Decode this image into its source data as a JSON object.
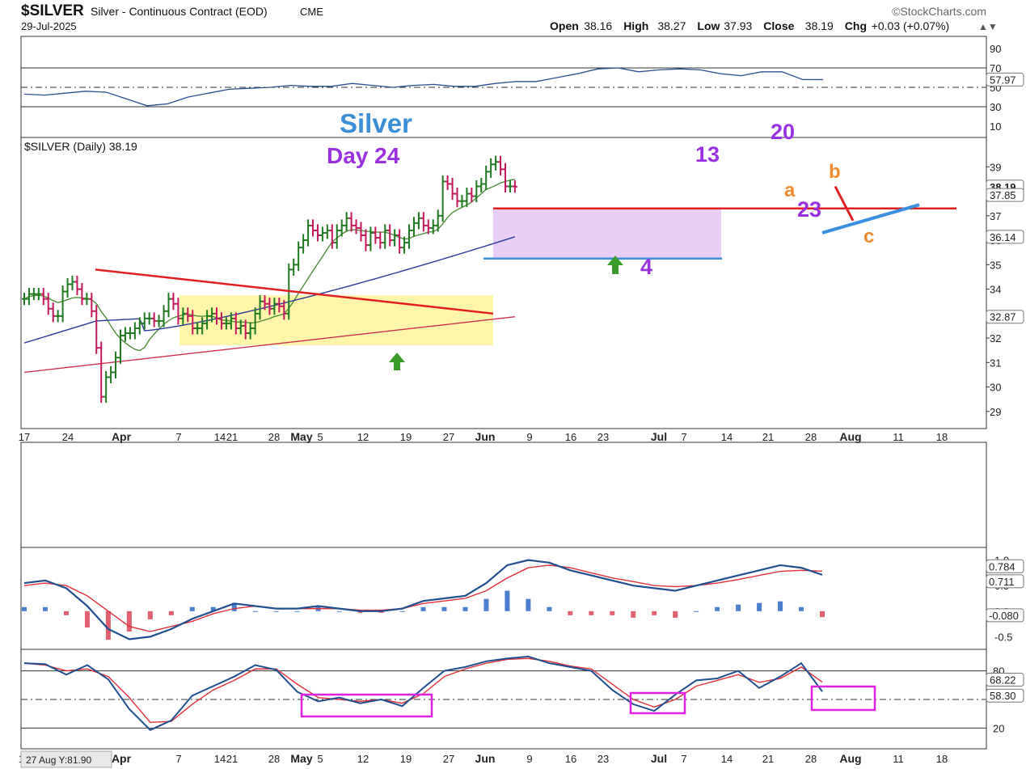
{
  "header": {
    "symbol": "$SILVER",
    "name": "Silver - Continuous Contract (EOD)",
    "exchange": "CME",
    "date": "29-Jul-2025",
    "brand": "©StockCharts.com",
    "ohlc": [
      {
        "label": "Open",
        "value": "38.16"
      },
      {
        "label": "High",
        "value": "38.27"
      },
      {
        "label": "Low",
        "value": "37.93"
      },
      {
        "label": "Close",
        "value": "38.19"
      },
      {
        "label": "Chg",
        "value": "+0.03 (+0.07%)"
      }
    ]
  },
  "colors": {
    "up": "#1f7a1f",
    "down": "#c2185b",
    "ma_short": "#4f8f3a",
    "ma_mid": "#2a3a9a",
    "ma_long": "#d03050",
    "macd": "#1f4f8f",
    "signal": "#e0303a",
    "hist_pos": "#4a7fd0",
    "hist_neg": "#e06070",
    "resistance": "#e02020",
    "support": "#3b8fe0",
    "highlight_yellow": "#fff59a",
    "highlight_purple": "#e6c8f5",
    "annotation_purple": "#9b30e0",
    "annotation_orange": "#f08a30",
    "annotation_blue": "#3a8fd8",
    "box_magenta": "#e020e0"
  },
  "annotations": {
    "title": "Silver",
    "day": "Day 24",
    "cycle_labels": [
      "13",
      "20",
      "23",
      "4"
    ],
    "wave_labels": [
      "a",
      "b",
      "c"
    ]
  },
  "price_panel": {
    "legend": "$SILVER (Daily) 38.19",
    "last_label": "38.19",
    "ma_labels": [
      "37.85",
      "36.14",
      "32.87"
    ],
    "y_ticks": [
      "39",
      "38",
      "37",
      "36",
      "35",
      "34",
      "33",
      "32",
      "31",
      "30",
      "29"
    ]
  },
  "rsi_panel": {
    "value_label": "57.97",
    "y_ticks": [
      "90",
      "70",
      "50",
      "30",
      "10"
    ]
  },
  "macd_panel": {
    "value_labels": [
      "0.784",
      "0.711",
      "-0.080"
    ],
    "y_ticks": [
      "1.0",
      "0.5",
      "0.0",
      "-0.5"
    ]
  },
  "stoch_panel": {
    "value_labels": [
      "68.22",
      "58.30"
    ],
    "y_ticks": [
      "80",
      "20"
    ]
  },
  "x_axis": {
    "labels": [
      "17",
      "24",
      "Apr",
      "7",
      "14",
      "21",
      "28",
      "May",
      "5",
      "12",
      "19",
      "27",
      "Jun",
      "9",
      "16",
      "23",
      "Jul",
      "7",
      "14",
      "21",
      "28",
      "Aug",
      "11",
      "18"
    ],
    "bold": [
      "Apr",
      "May",
      "Jun",
      "Jul",
      "Aug"
    ]
  },
  "cursor_readout": "27 Aug Y:81.90",
  "chart_data": [
    {
      "type": "ohlc",
      "title": "$SILVER (Daily) 38.19",
      "ylim": [
        28.3,
        40.2
      ],
      "closes": [
        33.6,
        33.8,
        33.8,
        33.8,
        33.6,
        33.2,
        32.9,
        32.9,
        33.9,
        34.2,
        34.3,
        34.0,
        33.6,
        33.6,
        33.1,
        31.6,
        29.6,
        30.4,
        30.6,
        31.2,
        32.1,
        32.2,
        32.2,
        32.4,
        32.6,
        32.8,
        32.8,
        32.7,
        32.7,
        33.1,
        33.6,
        33.4,
        32.8,
        33.0,
        32.9,
        32.4,
        32.4,
        32.6,
        32.9,
        33.0,
        32.8,
        32.6,
        32.6,
        32.8,
        32.4,
        32.5,
        32.2,
        32.4,
        33.0,
        33.5,
        33.4,
        33.2,
        33.4,
        33.3,
        33.0,
        34.8,
        35.0,
        35.7,
        36.0,
        36.6,
        36.4,
        36.2,
        36.3,
        36.4,
        35.9,
        36.4,
        36.6,
        36.9,
        36.6,
        36.5,
        36.2,
        35.8,
        36.3,
        36.1,
        35.9,
        36.4,
        36.0,
        36.2,
        35.7,
        35.9,
        36.4,
        36.7,
        36.9,
        36.6,
        36.5,
        36.6,
        37.0,
        38.4,
        38.3,
        37.9,
        37.6,
        37.6,
        37.9,
        37.8,
        38.2,
        38.3,
        38.8,
        39.1,
        39.2,
        38.9,
        38.2,
        38.2,
        38.19
      ],
      "ma_short": {
        "start": 33.3,
        "end": 37.85
      },
      "ma_mid_last": 36.14,
      "ma_long_last": 32.87
    },
    {
      "type": "line",
      "title": "RSI",
      "ylim": [
        0,
        100
      ],
      "values": [
        43,
        42,
        44,
        46,
        45,
        38,
        31,
        33,
        40,
        44,
        48,
        49,
        50,
        52,
        51,
        51,
        54,
        52,
        50,
        52,
        53,
        51,
        51,
        54,
        56,
        56,
        60,
        64,
        69,
        70,
        66,
        68,
        69,
        68,
        64,
        62,
        66,
        66,
        58,
        57.97
      ],
      "levels": [
        70,
        50,
        30
      ]
    },
    {
      "type": "line",
      "title": "MACD",
      "ylim": [
        -0.7,
        1.2
      ],
      "macd": [
        0.55,
        0.6,
        0.45,
        0.1,
        -0.35,
        -0.55,
        -0.5,
        -0.35,
        -0.15,
        0.0,
        0.15,
        0.1,
        0.05,
        0.05,
        0.1,
        0.05,
        0.0,
        0.0,
        0.05,
        0.2,
        0.25,
        0.3,
        0.55,
        0.9,
        1.0,
        0.95,
        0.8,
        0.7,
        0.6,
        0.5,
        0.45,
        0.4,
        0.5,
        0.6,
        0.7,
        0.8,
        0.9,
        0.85,
        0.711
      ],
      "signal": [
        0.5,
        0.55,
        0.5,
        0.3,
        0.0,
        -0.3,
        -0.4,
        -0.3,
        -0.2,
        -0.05,
        0.05,
        0.1,
        0.05,
        0.05,
        0.05,
        0.05,
        0.02,
        0.02,
        0.05,
        0.15,
        0.2,
        0.25,
        0.4,
        0.65,
        0.85,
        0.9,
        0.85,
        0.75,
        0.65,
        0.58,
        0.5,
        0.48,
        0.5,
        0.55,
        0.62,
        0.7,
        0.78,
        0.8,
        0.784
      ],
      "hist_last": -0.08
    },
    {
      "type": "line",
      "title": "Stochastic",
      "ylim": [
        0,
        100
      ],
      "k": [
        88,
        87,
        76,
        86,
        71,
        40,
        18,
        28,
        54,
        64,
        74,
        86,
        81,
        58,
        48,
        52,
        46,
        50,
        43,
        62,
        80,
        84,
        90,
        93,
        95,
        88,
        84,
        80,
        60,
        45,
        38,
        55,
        70,
        72,
        80,
        62,
        74,
        88,
        58.3
      ],
      "d": [
        88,
        86,
        80,
        82,
        74,
        52,
        26,
        27,
        45,
        60,
        70,
        82,
        82,
        66,
        52,
        50,
        48,
        50,
        46,
        56,
        74,
        82,
        88,
        92,
        93,
        90,
        85,
        82,
        66,
        50,
        42,
        50,
        64,
        70,
        76,
        68,
        72,
        84,
        68.22
      ],
      "levels": [
        80,
        50,
        20
      ]
    }
  ]
}
